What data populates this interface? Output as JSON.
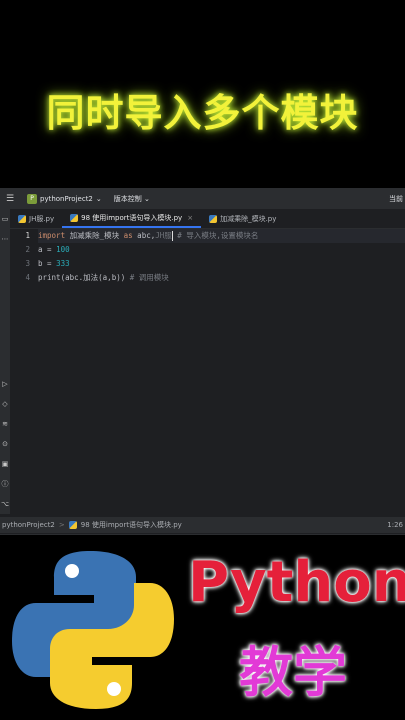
{
  "headline": "同时导入多个模块",
  "ide": {
    "topbar": {
      "project": "pythonProject2",
      "project_badge": "P",
      "vcs": "版本控制",
      "right_text": "当前"
    },
    "tabs": [
      {
        "label": "JH服.py",
        "active": false
      },
      {
        "label": "98 使用import语句导入模块.py",
        "active": true,
        "close": "×"
      },
      {
        "label": "加减乘除_模块.py",
        "active": false
      }
    ],
    "line_numbers": [
      "1",
      "2",
      "3",
      "4"
    ],
    "code": {
      "l1_kw": "import",
      "l1_mod1": " 加减乘除_模块 ",
      "l1_as": "as",
      "l1_alias": " abc,",
      "l1_mod2": "JH服",
      "l1_comment": " # 导入模块,设置模块名",
      "l2_var": "a = ",
      "l2_num": "100",
      "l3_var": "b = ",
      "l3_num": "333",
      "l4_code": "print(abc.加法(a,b))",
      "l4_comment": " # 调用模块"
    },
    "statusbar": {
      "crumb1": "pythonProject2",
      "sep": ">",
      "crumb2": "98 使用import语句导入模块.py",
      "right": "1:26"
    }
  },
  "brand": {
    "title": "Python",
    "subtitle": "教学"
  },
  "colors": {
    "headline": "#f2f23a",
    "python_blue": "#3a73b3",
    "python_yellow": "#f5cc2f",
    "brand_red": "#e5203a",
    "brand_magenta": "#e23ad6"
  }
}
